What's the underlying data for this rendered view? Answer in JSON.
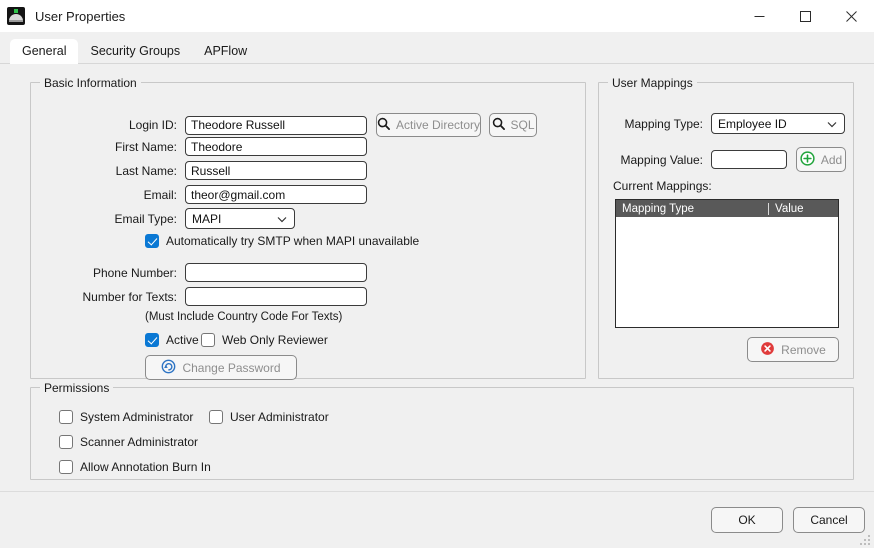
{
  "window": {
    "title": "User Properties",
    "icon": "app-logo-icon",
    "minimize": "—",
    "maximize": "□",
    "close": "✕"
  },
  "tabs": [
    {
      "label": "General",
      "active": true
    },
    {
      "label": "Security Groups",
      "active": false
    },
    {
      "label": "APFlow",
      "active": false
    }
  ],
  "basic_information": {
    "legend": "Basic Information",
    "fields": {
      "login_id": {
        "label": "Login ID:",
        "value": "Theodore Russell",
        "placeholder": ""
      },
      "first_name": {
        "label": "First Name:",
        "value": "Theodore",
        "placeholder": ""
      },
      "last_name": {
        "label": "Last Name:",
        "value": "Russell",
        "placeholder": ""
      },
      "email": {
        "label": "Email:",
        "value": "theor@gmail.com",
        "placeholder": ""
      },
      "email_type": {
        "label": "Email Type:",
        "value": "MAPI"
      },
      "phone_number": {
        "label": "Phone Number:",
        "value": "",
        "placeholder": ""
      },
      "number_for_texts": {
        "label": "Number for Texts:",
        "value": "",
        "placeholder": ""
      }
    },
    "active_directory_button": "Active Directory",
    "sql_button": "SQL",
    "smtp_checkbox": {
      "label": "Automatically try SMTP when MAPI unavailable",
      "checked": true
    },
    "texts_hint": "(Must Include Country Code For Texts)",
    "active_checkbox": {
      "label": "Active",
      "checked": true
    },
    "web_only_checkbox": {
      "label": "Web Only Reviewer",
      "checked": false
    },
    "change_password_button": "Change Password"
  },
  "user_mappings": {
    "legend": "User Mappings",
    "mapping_type": {
      "label": "Mapping Type:",
      "value": "Employee ID"
    },
    "mapping_value": {
      "label": "Mapping Value:",
      "value": "",
      "placeholder": ""
    },
    "add_button": "Add",
    "current_mappings_label": "Current Mappings:",
    "columns": [
      "Mapping Type",
      "Value"
    ],
    "rows": [],
    "remove_button": "Remove"
  },
  "permissions": {
    "legend": "Permissions",
    "items": [
      {
        "label": "System Administrator",
        "checked": false
      },
      {
        "label": "User Administrator",
        "checked": false
      },
      {
        "label": "Scanner Administrator",
        "checked": false
      },
      {
        "label": "Allow Annotation Burn In",
        "checked": false
      }
    ]
  },
  "footer": {
    "ok": "OK",
    "cancel": "Cancel"
  },
  "colors": {
    "accent_blue": "#0a78d4",
    "add_green": "#1fa33a",
    "remove_red": "#e03b3b",
    "window_bg": "#f0f0f0",
    "listview_header": "#595959"
  }
}
